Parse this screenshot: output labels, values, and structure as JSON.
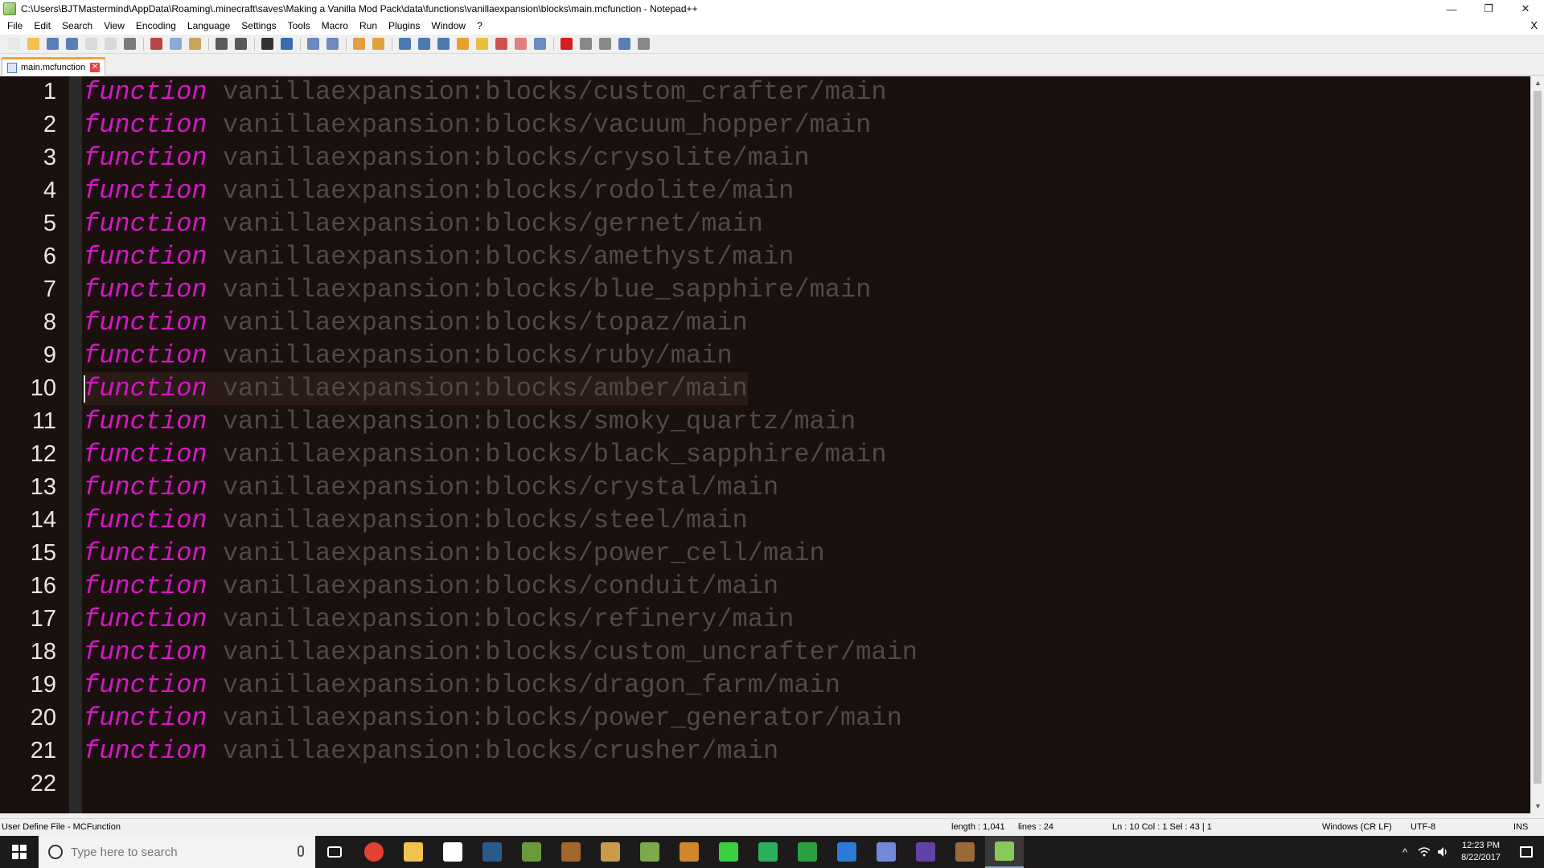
{
  "window": {
    "title": "C:\\Users\\BJTMastermind\\AppData\\Roaming\\.minecraft\\saves\\Making a Vanilla Mod Pack\\data\\functions\\vanillaexpansion\\blocks\\main.mcfunction - Notepad++",
    "minimize": "—",
    "restore": "❐",
    "close": "✕"
  },
  "menu": {
    "items": [
      "File",
      "Edit",
      "Search",
      "View",
      "Encoding",
      "Language",
      "Settings",
      "Tools",
      "Macro",
      "Run",
      "Plugins",
      "Window",
      "?"
    ],
    "close_doc": "X"
  },
  "toolbar": {
    "buttons": [
      {
        "name": "new-file-icon",
        "color": "#e8e8e8"
      },
      {
        "name": "open-file-icon",
        "color": "#f2c24f"
      },
      {
        "name": "save-icon",
        "color": "#5a7fb8"
      },
      {
        "name": "save-all-icon",
        "color": "#5a7fb8"
      },
      {
        "name": "close-icon",
        "color": "#d9d9d9"
      },
      {
        "name": "close-all-icon",
        "color": "#d9d9d9"
      },
      {
        "name": "print-icon",
        "color": "#7a7a7a"
      },
      {
        "name": "cut-icon",
        "color": "#b44"
      },
      {
        "name": "copy-icon",
        "color": "#8aa9d9"
      },
      {
        "name": "paste-icon",
        "color": "#c9a55a"
      },
      {
        "name": "undo-icon",
        "color": "#5a5a5a"
      },
      {
        "name": "redo-icon",
        "color": "#5a5a5a"
      },
      {
        "name": "find-icon",
        "color": "#333"
      },
      {
        "name": "replace-icon",
        "color": "#3a6ab0"
      },
      {
        "name": "zoom-in-icon",
        "color": "#6a8ac0"
      },
      {
        "name": "zoom-out-icon",
        "color": "#6a8ac0"
      },
      {
        "name": "sync-vertical-icon",
        "color": "#e0a040"
      },
      {
        "name": "sync-horizontal-icon",
        "color": "#e0a040"
      },
      {
        "name": "word-wrap-icon",
        "color": "#4a7ab0"
      },
      {
        "name": "show-all-characters-icon",
        "color": "#4a7ab0"
      },
      {
        "name": "indent-guide-icon",
        "color": "#4a7ab0"
      },
      {
        "name": "user-language-icon",
        "color": "#e8a030"
      },
      {
        "name": "doc-map-icon",
        "color": "#e8c040"
      },
      {
        "name": "function-list-icon",
        "color": "#d05050"
      },
      {
        "name": "folder-workspace-icon",
        "color": "#e08080"
      },
      {
        "name": "monitoring-icon",
        "color": "#6a8ac0"
      },
      {
        "name": "record-macro-icon",
        "color": "#d02020"
      },
      {
        "name": "stop-macro-icon",
        "color": "#888"
      },
      {
        "name": "play-macro-icon",
        "color": "#888"
      },
      {
        "name": "run-macro-multiple-icon",
        "color": "#5a7fb8"
      },
      {
        "name": "save-macro-icon",
        "color": "#888"
      }
    ]
  },
  "tab": {
    "label": "main.mcfunction",
    "close": "✕"
  },
  "editor": {
    "keyword": "function",
    "current_line": 10,
    "lines": [
      "vanillaexpansion:blocks/custom_crafter/main",
      "vanillaexpansion:blocks/vacuum_hopper/main",
      "vanillaexpansion:blocks/crysolite/main",
      "vanillaexpansion:blocks/rodolite/main",
      "vanillaexpansion:blocks/gernet/main",
      "vanillaexpansion:blocks/amethyst/main",
      "vanillaexpansion:blocks/blue_sapphire/main",
      "vanillaexpansion:blocks/topaz/main",
      "vanillaexpansion:blocks/ruby/main",
      "vanillaexpansion:blocks/amber/main",
      "vanillaexpansion:blocks/smoky_quartz/main",
      "vanillaexpansion:blocks/black_sapphire/main",
      "vanillaexpansion:blocks/crystal/main",
      "vanillaexpansion:blocks/steel/main",
      "vanillaexpansion:blocks/power_cell/main",
      "vanillaexpansion:blocks/conduit/main",
      "vanillaexpansion:blocks/refinery/main",
      "vanillaexpansion:blocks/custom_uncrafter/main",
      "vanillaexpansion:blocks/dragon_farm/main",
      "vanillaexpansion:blocks/power_generator/main",
      "vanillaexpansion:blocks/crusher/main",
      ""
    ],
    "line_numbers": [
      "1",
      "2",
      "3",
      "4",
      "5",
      "6",
      "7",
      "8",
      "9",
      "10",
      "11",
      "12",
      "13",
      "14",
      "15",
      "16",
      "17",
      "18",
      "19",
      "20",
      "21",
      "22"
    ],
    "keyword_color": "#d816c8",
    "text_color": "#4d4a49",
    "background_color": "#1a100e"
  },
  "statusbar": {
    "language": "User Define File - MCFunction",
    "length": "length : 1,041",
    "lines": "lines : 24",
    "position": "Ln : 10    Col : 1    Sel : 43 | 1",
    "eol": "Windows (CR LF)",
    "encoding": "UTF-8",
    "mode": "INS"
  },
  "taskbar": {
    "search_placeholder": "Type here to search",
    "apps": [
      {
        "name": "task-view-icon",
        "color": "#ffffff"
      },
      {
        "name": "chrome-icon",
        "color": "#e34133"
      },
      {
        "name": "file-explorer-icon",
        "color": "#f2c24f"
      },
      {
        "name": "store-icon",
        "color": "#ffffff"
      },
      {
        "name": "steam-icon",
        "color": "#2a5a8a"
      },
      {
        "name": "minecraft-icon",
        "color": "#6a9a3a"
      },
      {
        "name": "minecraft-chest-icon",
        "color": "#a0682a"
      },
      {
        "name": "package-icon",
        "color": "#c89a4a"
      },
      {
        "name": "mcedit-icon",
        "color": "#7aaa4a"
      },
      {
        "name": "spider-app-icon",
        "color": "#d0862a"
      },
      {
        "name": "razer-icon",
        "color": "#3ad040"
      },
      {
        "name": "hexagon-app-icon",
        "color": "#2ab05a"
      },
      {
        "name": "bar-chart-app-icon",
        "color": "#2aa040"
      },
      {
        "name": "c-app-icon",
        "color": "#2a7ad8"
      },
      {
        "name": "discord-icon",
        "color": "#7289da"
      },
      {
        "name": "twitch-icon",
        "color": "#6441a4"
      },
      {
        "name": "crafting-table-icon",
        "color": "#9a6a3a"
      },
      {
        "name": "notepad-plus-plus-icon",
        "color": "#8ac85a"
      }
    ],
    "clock_time": "12:23 PM",
    "clock_date": "8/22/2017"
  }
}
